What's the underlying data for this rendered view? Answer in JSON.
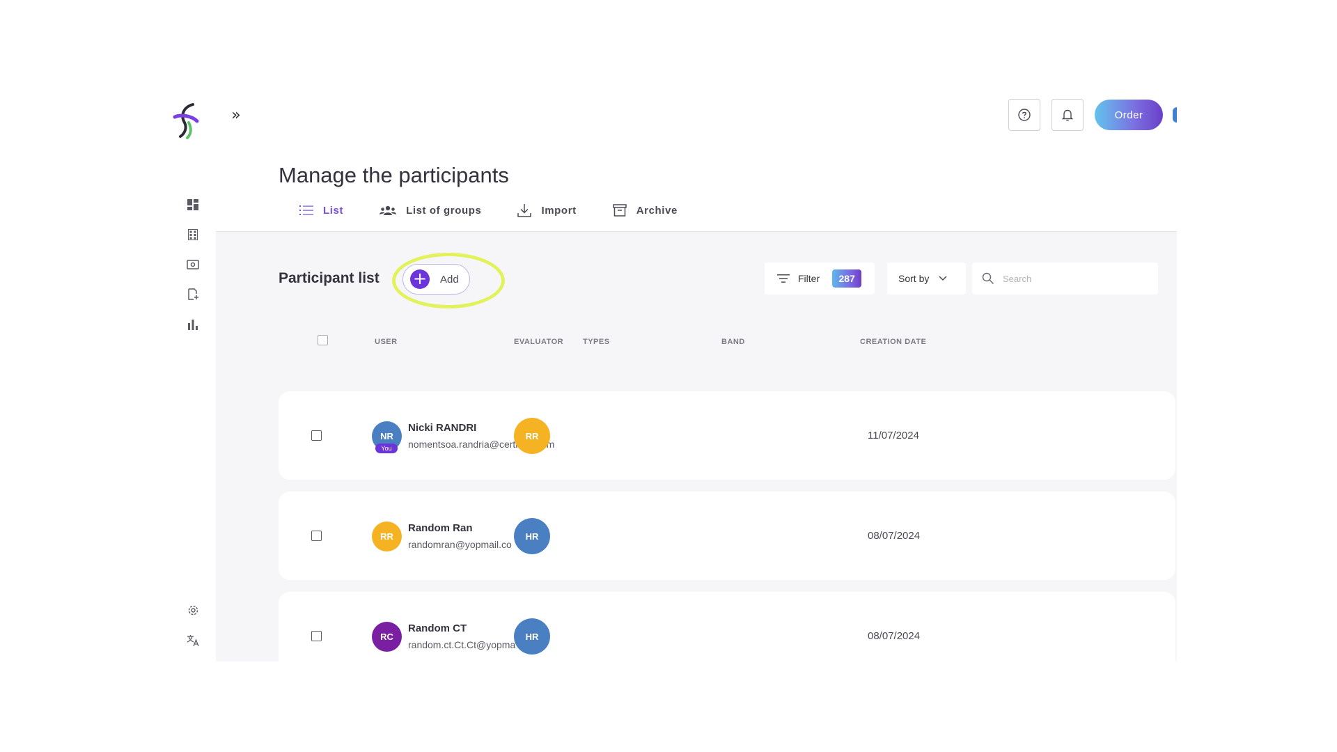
{
  "sidebar": {
    "logo": "app-logo",
    "expand_icon": "double-chevron-right-icon",
    "nav_icons": [
      "dashboard-icon",
      "grid-icon",
      "screen-icon",
      "document-add-icon",
      "bar-chart-icon"
    ],
    "bottom_icons": [
      "gear-icon",
      "translate-icon"
    ]
  },
  "header": {
    "help_icon": "help-circle-icon",
    "notification_icon": "bell-icon",
    "order_label": "Order"
  },
  "page": {
    "title": "Manage the participants"
  },
  "tabs": [
    {
      "label": "List",
      "icon": "list-icon",
      "active": true
    },
    {
      "label": "List of groups",
      "icon": "group-icon",
      "active": false
    },
    {
      "label": "Import",
      "icon": "download-icon",
      "active": false
    },
    {
      "label": "Archive",
      "icon": "archive-icon",
      "active": false
    }
  ],
  "toolbar": {
    "list_title": "Participant list",
    "add_label": "Add",
    "filter_label": "Filter",
    "count": "287",
    "sort_label": "Sort by",
    "search_placeholder": "Search"
  },
  "table": {
    "columns": [
      "USER",
      "EVALUATOR",
      "TYPES",
      "BAND",
      "CREATION DATE"
    ],
    "rows": [
      {
        "initials": "NR",
        "avatar_color": "#4a7fc1",
        "you_tag": "You",
        "name": "Nicki RANDRI",
        "email": "nomentsoa.randria@certi...st.com",
        "evaluator_initials": "RR",
        "evaluator_color": "#f5b324",
        "creation_date": "11/07/2024"
      },
      {
        "initials": "RR",
        "avatar_color": "#f5b324",
        "name": "Random Ran",
        "email": "randomran@yopmail.co",
        "evaluator_initials": "HR",
        "evaluator_color": "#4a7fc1",
        "creation_date": "08/07/2024"
      },
      {
        "initials": "RC",
        "avatar_color": "#7b1fa2",
        "name": "Random CT",
        "email": "random.ct.Ct.Ct@yopma",
        "evaluator_initials": "HR",
        "evaluator_color": "#4a7fc1",
        "creation_date": "08/07/2024"
      }
    ]
  },
  "colors": {
    "accent": "#7a4fe0",
    "highlight_ring": "#e2f25a"
  }
}
